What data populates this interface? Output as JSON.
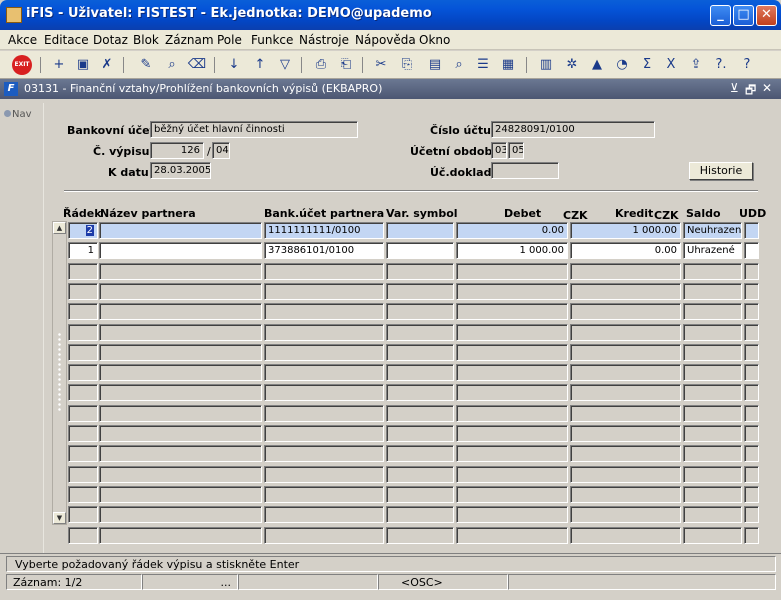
{
  "window": {
    "title": "iFIS - Uživatel: FISTEST - Ek.jednotka: DEMO@upademo",
    "minimize": "_",
    "maximize": "□",
    "close": "✕"
  },
  "menu": [
    "Akce",
    "Editace",
    "Dotaz",
    "Blok",
    "Záznam",
    "Pole",
    "Funkce",
    "Nástroje",
    "Nápověda",
    "Okno"
  ],
  "toolbar": {
    "exit_label": "EXIT",
    "icons": [
      "exit-icon",
      "insert-record-icon",
      "save-icon",
      "delete-record-icon",
      "search-icon",
      "query-icon",
      "clear-query-icon",
      "sort-asc-icon",
      "sort-desc-icon",
      "filter-icon",
      "print-icon",
      "print-preview-icon",
      "cut-icon",
      "copy-icon",
      "paste-icon",
      "find-icon",
      "list-icon",
      "table-icon",
      "calculator-icon",
      "settings-icon",
      "chart-icon",
      "pie-icon",
      "sum-icon",
      "excel-icon",
      "export-icon",
      "help-topics-icon",
      "help-icon"
    ],
    "glyphs": [
      "EXIT",
      "+",
      "▣",
      "✗",
      "✎",
      "⌕",
      "⌫",
      "↓",
      "↑",
      "▽",
      "⎙",
      "⎗",
      "✂",
      "⎘",
      "▤",
      "⌕",
      "☰",
      "▦",
      "▥",
      "✲",
      "▲",
      "◔",
      "Σ",
      "X",
      "⇪",
      "?.",
      "?"
    ]
  },
  "form": {
    "title": "03131 - Finanční vztahy/Prohlížení bankovních výpisů (EKBAPRO)",
    "controls": [
      "⊻",
      "🗗",
      "✕"
    ],
    "nav_label": "Nav"
  },
  "header": {
    "bankovni_ucet_label": "Bankovní účet",
    "bankovni_ucet_value": "běžný účet hlavní činnosti",
    "cislo_uctu_label": "Číslo účtu",
    "cislo_uctu_value": "24828091/0100",
    "c_vypisu_label": "Č. výpisu",
    "c_vypisu_value": "126",
    "c_vypisu_sep": "/",
    "c_vypisu_suffix": "04",
    "ucetni_obdobi_label": "Účetní období",
    "obdobi_month": "03",
    "obdobi_year": "05",
    "k_datu_label": "K datu",
    "k_datu_value": "28.03.2005",
    "uc_doklad_label": "Úč.doklad",
    "uc_doklad_value": "",
    "historie_button": "Historie"
  },
  "table": {
    "columns": {
      "radek": "Řádek",
      "nazev_partnera": "Název partnera",
      "bank_ucet": "Bank.účet partnera",
      "var_symbol": "Var. symbol",
      "debet": "Debet",
      "debet_currency": "CZK",
      "kredit": "Kredit",
      "kredit_currency": "CZK",
      "saldo": "Saldo",
      "udd": "UDD"
    },
    "rows": [
      {
        "radek": "2",
        "nazev": "",
        "ucet": "1111111111/0100",
        "vs": "",
        "debet": "0.00",
        "kredit": "1 000.00",
        "saldo": "Neuhrazené"
      },
      {
        "radek": "1",
        "nazev": "",
        "ucet": "373886101/0100",
        "vs": "",
        "debet": "1 000.00",
        "kredit": "0.00",
        "saldo": "Uhrazené"
      }
    ],
    "empty_rows": 14
  },
  "status": {
    "message": "Vyberte požadovaný řádek výpisu a stiskněte Enter",
    "record": "Záznam: 1/2",
    "dots": "...",
    "osc": "<OSC>"
  }
}
